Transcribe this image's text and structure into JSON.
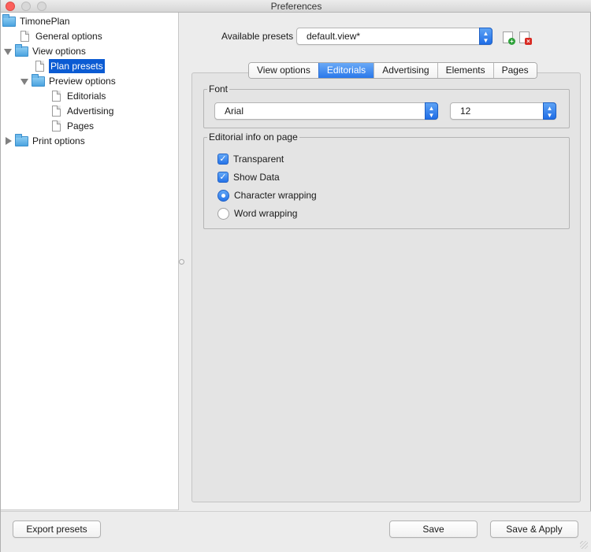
{
  "window": {
    "title": "Preferences"
  },
  "tree": {
    "root": "TimonePlan",
    "general_options": "General options",
    "view_options": "View options",
    "plan_presets": "Plan presets",
    "preview_options": "Preview options",
    "editorials": "Editorials",
    "advertising": "Advertising",
    "pages": "Pages",
    "print_options": "Print options"
  },
  "presets": {
    "label": "Available presets",
    "selected": "default.view*",
    "new_icon": "new-preset-icon",
    "delete_icon": "delete-preset-icon"
  },
  "tabs": [
    {
      "label": "View options",
      "active": false
    },
    {
      "label": "Editorials",
      "active": true
    },
    {
      "label": "Advertising",
      "active": false
    },
    {
      "label": "Elements",
      "active": false
    },
    {
      "label": "Pages",
      "active": false
    }
  ],
  "font": {
    "legend": "Font",
    "family": "Arial",
    "size": "12"
  },
  "editorial_info": {
    "legend": "Editorial info on page",
    "transparent": {
      "label": "Transparent",
      "checked": true
    },
    "show_data": {
      "label": "Show Data",
      "checked": true
    },
    "char_wrapping": {
      "label": "Character wrapping",
      "selected": true
    },
    "word_wrapping": {
      "label": "Word wrapping",
      "selected": false
    }
  },
  "buttons": {
    "export": "Export presets",
    "save": "Save",
    "save_apply": "Save & Apply"
  },
  "colors": {
    "accent": "#2a78ea",
    "selection": "#0b5bd3"
  }
}
